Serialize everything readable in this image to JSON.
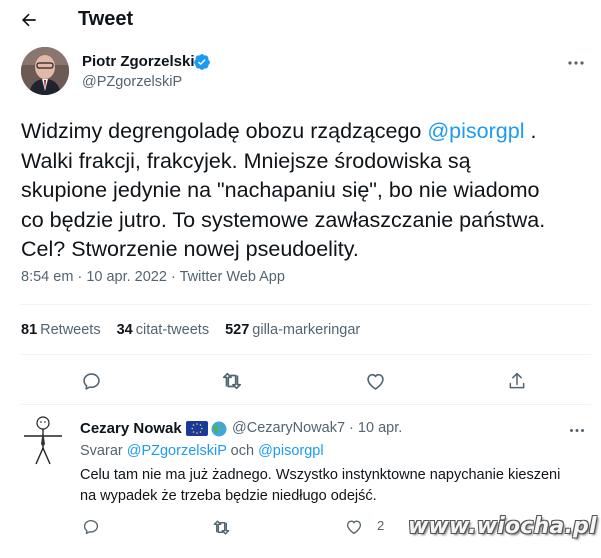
{
  "header": {
    "title": "Tweet",
    "back_icon": "arrow-left-icon"
  },
  "tweet": {
    "author_name": "Piotr Zgorzelski",
    "author_handle": "@PZgorzelskiP",
    "lines": [
      {
        "before": "Widzimy degrengoladę obozu rządzącego ",
        "mention": "@pisorgpl",
        "after": " ."
      },
      {
        "before": "Walki frakcji, frakcyjek. Mniejsze środowiska są"
      },
      {
        "before": "skupione jedynie na \"nachapaniu się\", bo nie wiadomo"
      },
      {
        "before": "co będzie jutro. To systemowe zawłaszczanie państwa."
      },
      {
        "before": "Cel? Stworzenie nowej pseudoelity."
      }
    ],
    "time": "8:54 em",
    "separator": "·",
    "date": "10 apr. 2022",
    "source": "Twitter Web App"
  },
  "stats": {
    "retweets_count": "81",
    "retweets_label": "Retweets",
    "quotes_count": "34",
    "quotes_label": "citat-tweets",
    "likes_count": "527",
    "likes_label": "gilla-markeringar"
  },
  "reply": {
    "author_name": "Cezary Nowak",
    "handle_date": "@CezaryNowak7 · 10 apr.",
    "replying_prefix": "Svarar",
    "replying_to_1": "@PZgorzelskiP",
    "replying_and": "och",
    "replying_to_2": "@pisorgpl",
    "text_line1": "Celu tam nie ma już żadnego. Wszystko instynktowne napychanie kieszeni",
    "text_line2": "na wypadek że trzeba będzie niedługo odejść.",
    "like_count": "2"
  },
  "watermark": "www.wiocha.pl",
  "colors": {
    "accent": "#1d9bf0",
    "text": "#0f1419",
    "secondary": "#536471",
    "divider": "#eff3f4"
  }
}
